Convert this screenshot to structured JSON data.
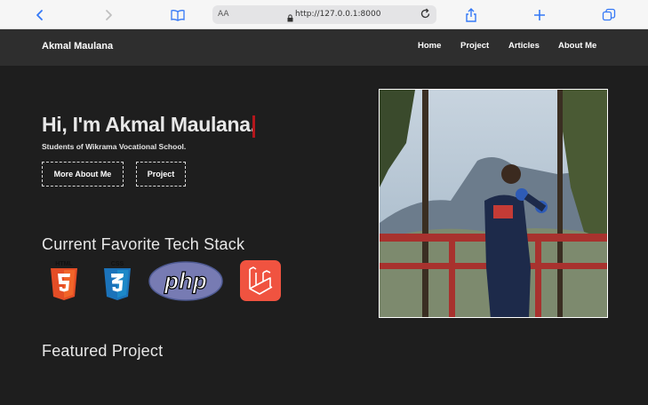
{
  "browser": {
    "url_text_size": "AA",
    "url": "http://127.0.0.1:8000"
  },
  "site": {
    "brand": "Akmal Maulana",
    "nav": [
      "Home",
      "Project",
      "Articles",
      "About Me"
    ]
  },
  "hero": {
    "title": "Hi, I'm Akmal Maulana.",
    "subtitle": "Students of Wikrama Vocational School.",
    "buttons": [
      "More About Me",
      "Project"
    ]
  },
  "tech_stack": {
    "title": "Current Favorite Tech Stack",
    "logos": [
      {
        "name": "html5-logo",
        "caption": "HTML",
        "color": "#e44d26"
      },
      {
        "name": "css3-logo",
        "caption": "CSS",
        "color": "#1b73ba"
      },
      {
        "name": "php-logo",
        "caption": "php",
        "color": "#777bb3"
      },
      {
        "name": "laravel-logo",
        "caption": "",
        "color": "#f05340"
      }
    ]
  },
  "featured": {
    "title": "Featured Project"
  }
}
